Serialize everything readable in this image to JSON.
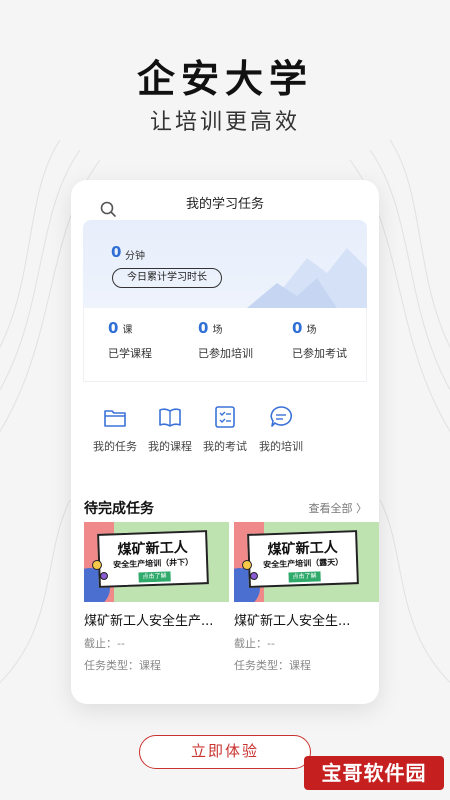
{
  "hero": {
    "title": "企安大学",
    "subtitle": "让培训更高效"
  },
  "app": {
    "header_title": "我的学习任务",
    "icons": {
      "search": "search-icon"
    },
    "study_time": {
      "value": "0",
      "unit": "分钟",
      "label": "今日累计学习时长"
    },
    "counts": [
      {
        "value": "0",
        "unit": "课",
        "label": "已学课程"
      },
      {
        "value": "0",
        "unit": "场",
        "label": "已参加培训"
      },
      {
        "value": "0",
        "unit": "场",
        "label": "已参加考试"
      }
    ],
    "quick_links": [
      {
        "label": "我的任务",
        "icon": "folder-icon"
      },
      {
        "label": "我的课程",
        "icon": "book-icon"
      },
      {
        "label": "我的考试",
        "icon": "checklist-icon"
      },
      {
        "label": "我的培训",
        "icon": "chat-icon"
      }
    ],
    "pending": {
      "title": "待完成任务",
      "view_all": "查看全部 〉",
      "tasks": [
        {
          "image_title": "煤矿新工人",
          "image_subtitle": "安全生产培训（井下）",
          "image_button": "点击了解",
          "name": "煤矿新工人安全生产...",
          "deadline": "截止：--",
          "type": "任务类型：课程"
        },
        {
          "image_title": "煤矿新工人",
          "image_subtitle": "安全生产培训（露天）",
          "image_button": "点击了解",
          "name": "煤矿新工人安全生...",
          "deadline": "截止：--",
          "type": "任务类型：课程"
        }
      ]
    }
  },
  "cta_label": "立即体验",
  "watermark": "宝哥软件园",
  "colors": {
    "accent_blue": "#2f6fd6",
    "cta_red": "#c9332f",
    "watermark_red": "#c51f1f"
  }
}
